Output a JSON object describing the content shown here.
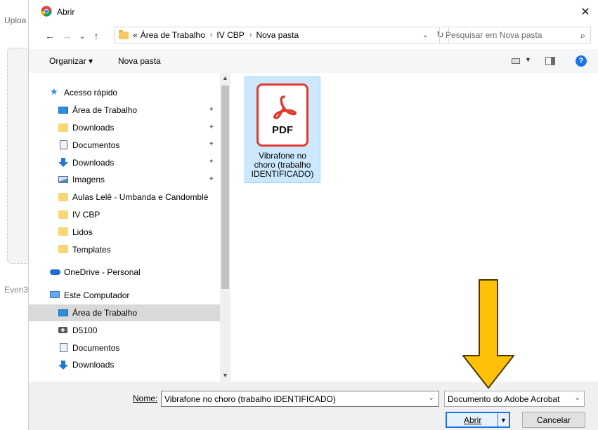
{
  "background": {
    "upload_label": "Uploa",
    "footer_label": "Even3"
  },
  "dialog": {
    "title": "Abrir",
    "close_glyph": "✕"
  },
  "nav_buttons": {
    "back": "←",
    "forward": "→",
    "recent": "⌄",
    "up": "↑"
  },
  "address_bar": {
    "overflow": "«",
    "crumbs": [
      "Área de Trabalho",
      "IV CBP",
      "Nova pasta"
    ],
    "separator": "›",
    "dropdown_glyph": "⌄",
    "refresh_glyph": "↻"
  },
  "search": {
    "placeholder": "Pesquisar em Nova pasta",
    "icon": "⌕"
  },
  "toolbar": {
    "organize": "Organizar ▾",
    "new_folder": "Nova pasta",
    "help": "?"
  },
  "nav_pane": {
    "items": [
      {
        "label": "Acesso rápido",
        "icon": "star-icon",
        "top": true,
        "pinned": false
      },
      {
        "label": "Área de Trabalho",
        "icon": "desktop-icon",
        "pinned": true
      },
      {
        "label": "Downloads",
        "icon": "folder-icon",
        "pinned": true
      },
      {
        "label": "Documentos",
        "icon": "document-icon",
        "pinned": true
      },
      {
        "label": "Downloads",
        "icon": "download-icon",
        "pinned": true
      },
      {
        "label": "Imagens",
        "icon": "image-icon",
        "pinned": true
      },
      {
        "label": "Aulas Lelê - Umbanda e Candomblé",
        "icon": "folder-icon",
        "pinned": false
      },
      {
        "label": "IV CBP",
        "icon": "folder-icon",
        "pinned": false
      },
      {
        "label": "Lidos",
        "icon": "folder-icon",
        "pinned": false
      },
      {
        "label": "Templates",
        "icon": "folder-icon",
        "pinned": false
      },
      {
        "label": "OneDrive - Personal",
        "icon": "cloud-icon",
        "top": true,
        "gap": true,
        "pinned": false
      },
      {
        "label": "Este Computador",
        "icon": "computer-icon",
        "top": true,
        "gap": true,
        "pinned": false
      },
      {
        "label": "Área de Trabalho",
        "icon": "desktop-icon",
        "selected": true,
        "pinned": false
      },
      {
        "label": "D5100",
        "icon": "camera-icon",
        "pinned": false
      },
      {
        "label": "Documentos",
        "icon": "document-icon",
        "pinned": false
      },
      {
        "label": "Downloads",
        "icon": "download-icon",
        "pinned": false
      }
    ],
    "pin_glyph": "📌"
  },
  "files": [
    {
      "name": "Vibrafone no choro (trabalho IDENTIFICADO)",
      "name_lines": [
        "Vibrafone no",
        "choro (trabalho",
        "IDENTIFICADO)"
      ],
      "type_badge": "PDF",
      "icon": "pdf-file-icon",
      "selected": true
    }
  ],
  "footer": {
    "name_label": "Nome:",
    "file_name_value": "Vibrafone no choro (trabalho IDENTIFICADO)",
    "file_type_value": "Documento do Adobe Acrobat",
    "open_label": "Abrir",
    "cancel_label": "Cancelar"
  },
  "colors": {
    "accent": "#1a73e8",
    "selection": "#cce8ff",
    "pdf_red": "#e23b2e",
    "arrow_fill": "#ffc107"
  }
}
